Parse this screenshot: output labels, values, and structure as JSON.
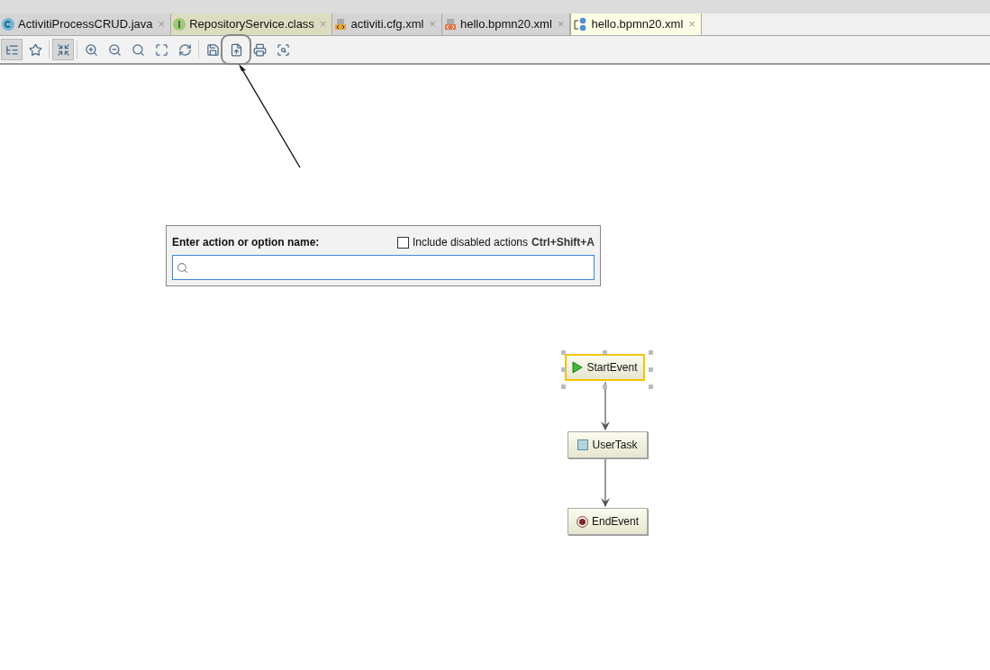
{
  "tabs": [
    {
      "label": "ActivitiProcessCRUD.java",
      "kind": "class",
      "selected": false,
      "close": "×"
    },
    {
      "label": "RepositoryService.class",
      "kind": "interface",
      "selected": false,
      "close": "×"
    },
    {
      "label": "activiti.cfg.xml",
      "kind": "xml",
      "selected": false,
      "close": "×"
    },
    {
      "label": "hello.bpmn20.xml",
      "kind": "xml-text",
      "selected": false,
      "close": "×"
    },
    {
      "label": "hello.bpmn20.xml",
      "kind": "diagram",
      "selected": true,
      "close": "×"
    }
  ],
  "toolbar": [
    {
      "kind": "structure",
      "selected": true,
      "highlighted": false
    },
    {
      "kind": "star",
      "selected": false,
      "highlighted": false
    },
    {
      "kind": "collapse",
      "selected": true,
      "highlighted": false
    },
    {
      "kind": "zoom-in",
      "selected": false,
      "highlighted": false
    },
    {
      "kind": "zoom-out",
      "selected": false,
      "highlighted": false
    },
    {
      "kind": "actual-size",
      "selected": false,
      "highlighted": false
    },
    {
      "kind": "fit",
      "selected": false,
      "highlighted": false
    },
    {
      "kind": "layout",
      "selected": false,
      "highlighted": false
    },
    {
      "kind": "save",
      "selected": false,
      "highlighted": false
    },
    {
      "kind": "export",
      "selected": false,
      "highlighted": true
    },
    {
      "kind": "print",
      "selected": false,
      "highlighted": false
    },
    {
      "kind": "preview",
      "selected": false,
      "highlighted": false
    }
  ],
  "action_popup": {
    "title": "Enter action or option name:",
    "checkbox": {
      "label": "Include disabled actions",
      "checked": false
    },
    "shortcut": "Ctrl+Shift+A"
  },
  "diagram": {
    "nodes": [
      {
        "label": "StartEvent",
        "kind": "start",
        "selected": true
      },
      {
        "label": "UserTask",
        "kind": "task",
        "selected": false
      },
      {
        "label": "EndEvent",
        "kind": "end",
        "selected": false
      }
    ]
  }
}
